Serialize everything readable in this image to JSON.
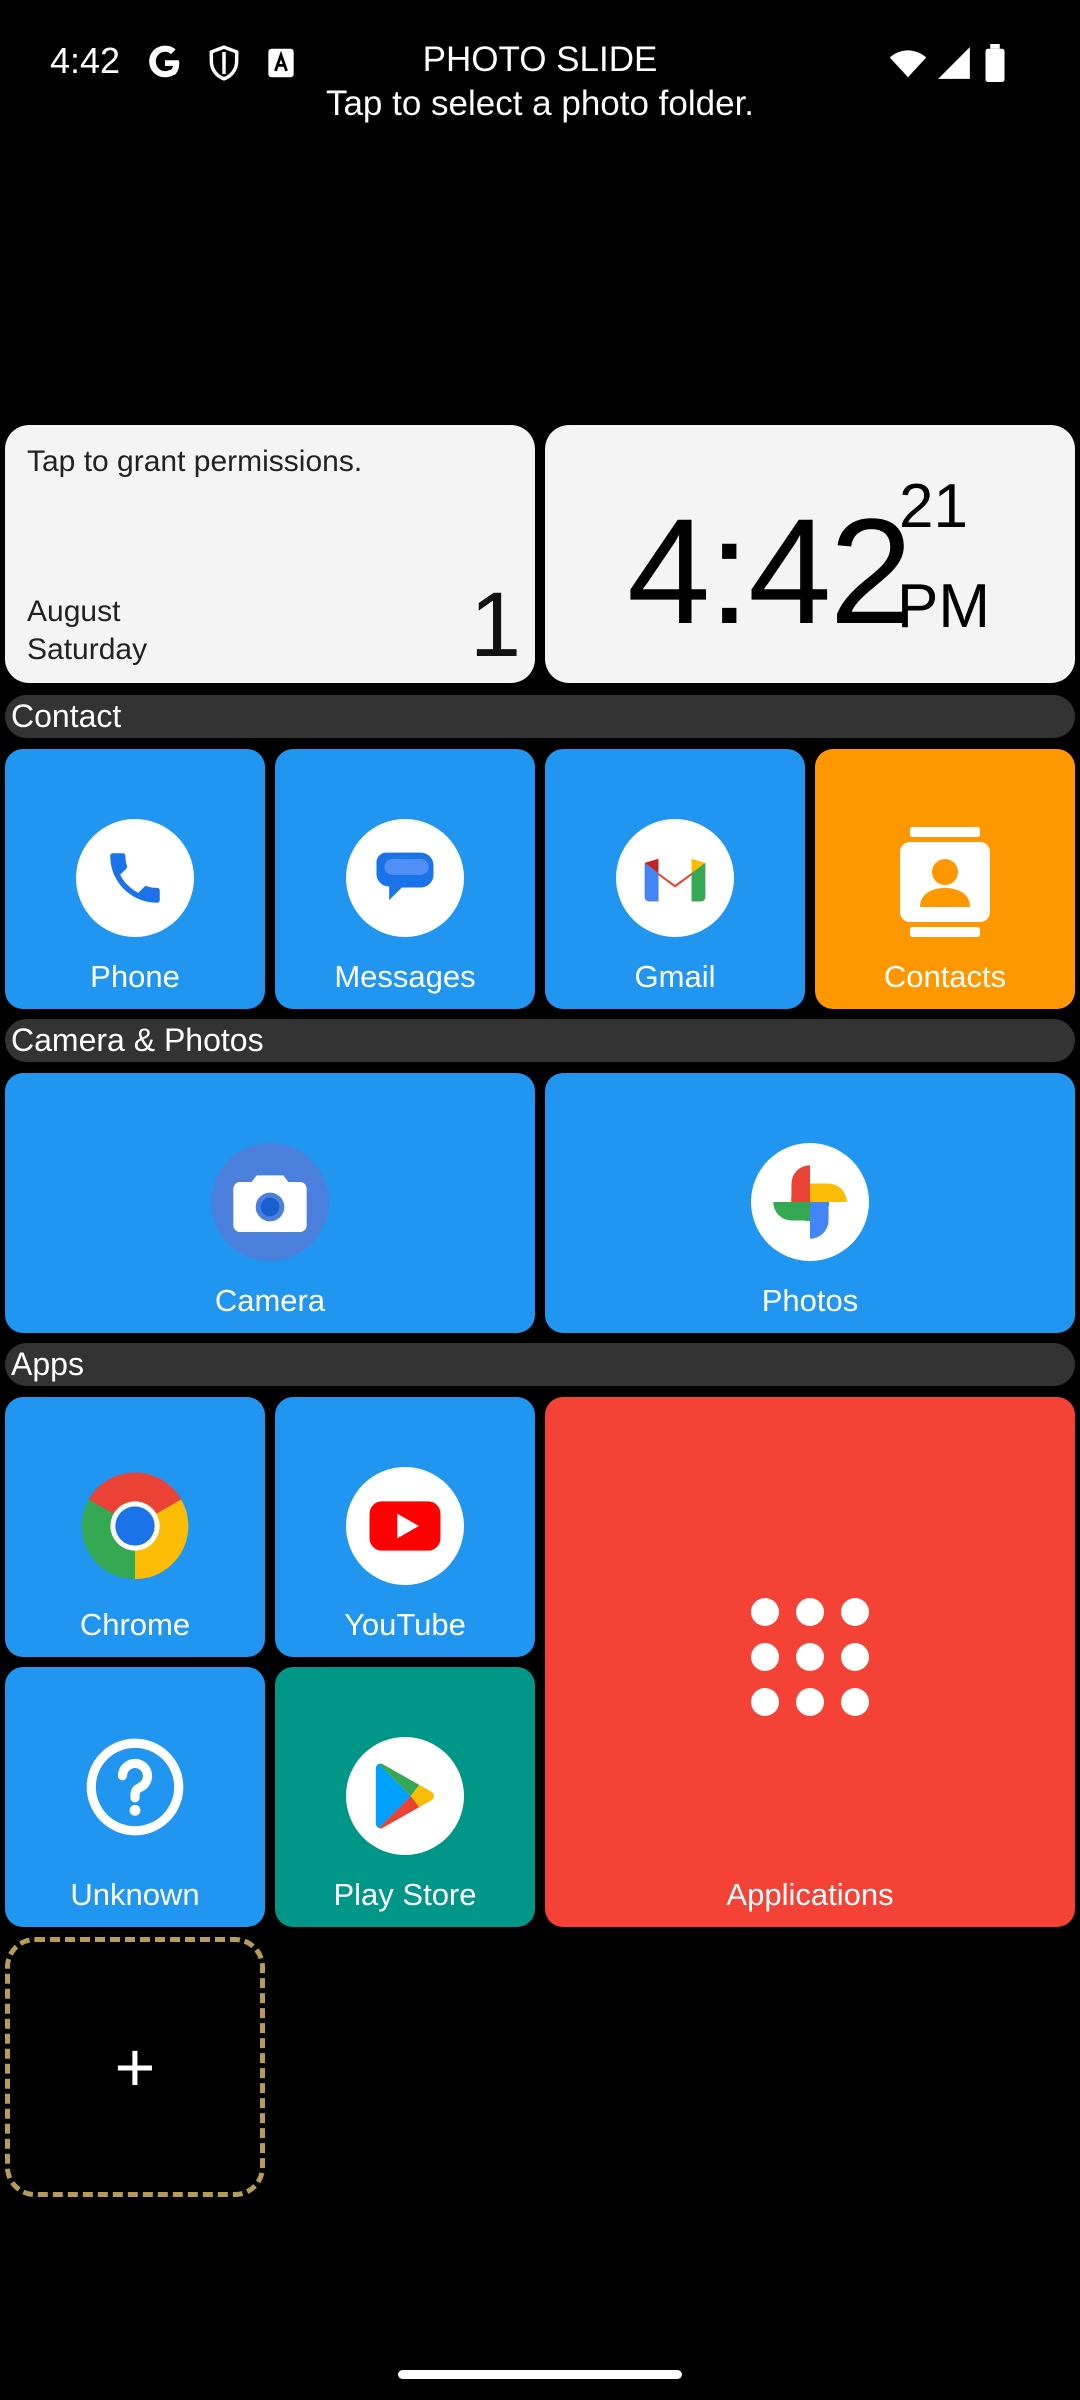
{
  "status_bar": {
    "time": "4:42"
  },
  "header": {
    "title": "PHOTO SLIDE",
    "subtitle": "Tap to select a photo folder."
  },
  "calendar_widget": {
    "permission_text": "Tap to grant permissions.",
    "month": "August",
    "weekday": "Saturday",
    "day": "1"
  },
  "clock_widget": {
    "time": "4:42",
    "seconds": "21",
    "ampm": "PM"
  },
  "sections": {
    "contact": "Contact",
    "camera_photos": "Camera & Photos",
    "apps": "Apps"
  },
  "tiles": {
    "phone": "Phone",
    "messages": "Messages",
    "gmail": "Gmail",
    "contacts": "Contacts",
    "camera": "Camera",
    "photos": "Photos",
    "chrome": "Chrome",
    "youtube": "YouTube",
    "unknown": "Unknown",
    "play_store": "Play Store",
    "applications": "Applications"
  },
  "add_tile": {
    "symbol": "+"
  },
  "colors": {
    "tile_blue": "#2196f0",
    "tile_orange": "#ff9800",
    "tile_teal": "#009688",
    "tile_red": "#f44336",
    "section_bar": "#333333",
    "add_border": "#b89b56"
  }
}
